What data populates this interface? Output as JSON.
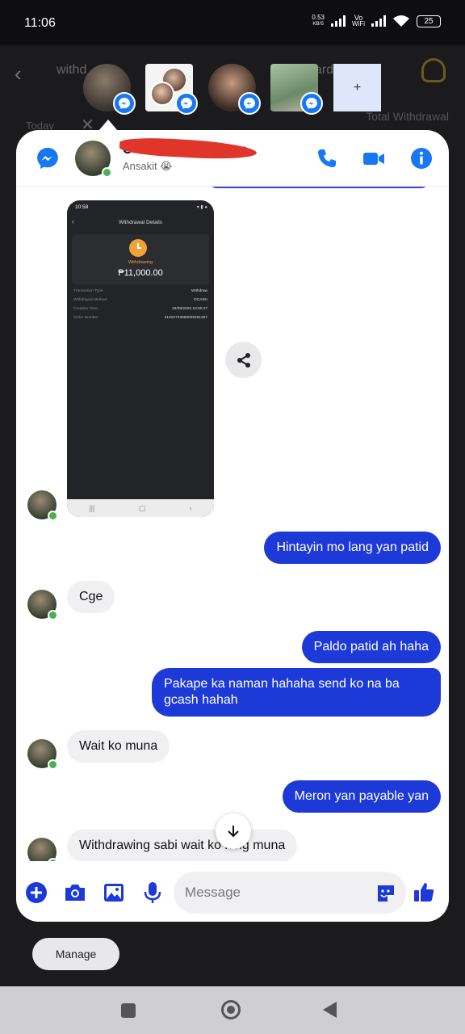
{
  "status_bar": {
    "time": "11:06",
    "net_speed_value": "0.53",
    "net_speed_unit": "KB/S",
    "volte_top": "Vo",
    "volte_bottom": "WiFi",
    "battery": "25"
  },
  "background_app": {
    "tab_left": "withd",
    "tab_left2": "ng",
    "tab_right": "ards",
    "tab_right2": "rds",
    "filter": "Today",
    "total_label": "Total Withdrawal"
  },
  "chat_heads": {
    "add_label": "+"
  },
  "chat": {
    "header": {
      "contact_name": "C",
      "contact_name_tail": "ra",
      "status": "Ansakit 😭",
      "accent": "#1877f2"
    },
    "screenshot": {
      "time": "10:58",
      "title": "Withdrawal Details",
      "status_label": "Withdrawing",
      "amount": "₱11,000.00",
      "rows": [
        {
          "label": "Transaction Type",
          "value": "Withdraw"
        },
        {
          "label": "Withdrawal Method",
          "value": "GCASH"
        },
        {
          "label": "Creation Time",
          "value": "19/09/2025 10:50:27"
        },
        {
          "label": "Order Number",
          "value": "31010733088005491367"
        }
      ]
    },
    "messages": [
      {
        "from": "me",
        "text": "Hintayin mo lang yan patid"
      },
      {
        "from": "them",
        "text": "Cge"
      },
      {
        "from": "me",
        "text": "Paldo patid ah haha"
      },
      {
        "from": "me",
        "text": "Pakape ka naman hahaha send ko na ba gcash hahah"
      },
      {
        "from": "them",
        "text": "Wait ko muna"
      },
      {
        "from": "me",
        "text": "Meron yan payable yan"
      },
      {
        "from": "them",
        "text": "Withdrawing sabi wait ko nlng muna"
      }
    ],
    "composer": {
      "placeholder": "Message"
    },
    "colors": {
      "outgoing_bubble": "#1d3ad8",
      "incoming_bubble": "#f0f0f2",
      "online": "#4caf50"
    }
  },
  "manage_button": "Manage"
}
